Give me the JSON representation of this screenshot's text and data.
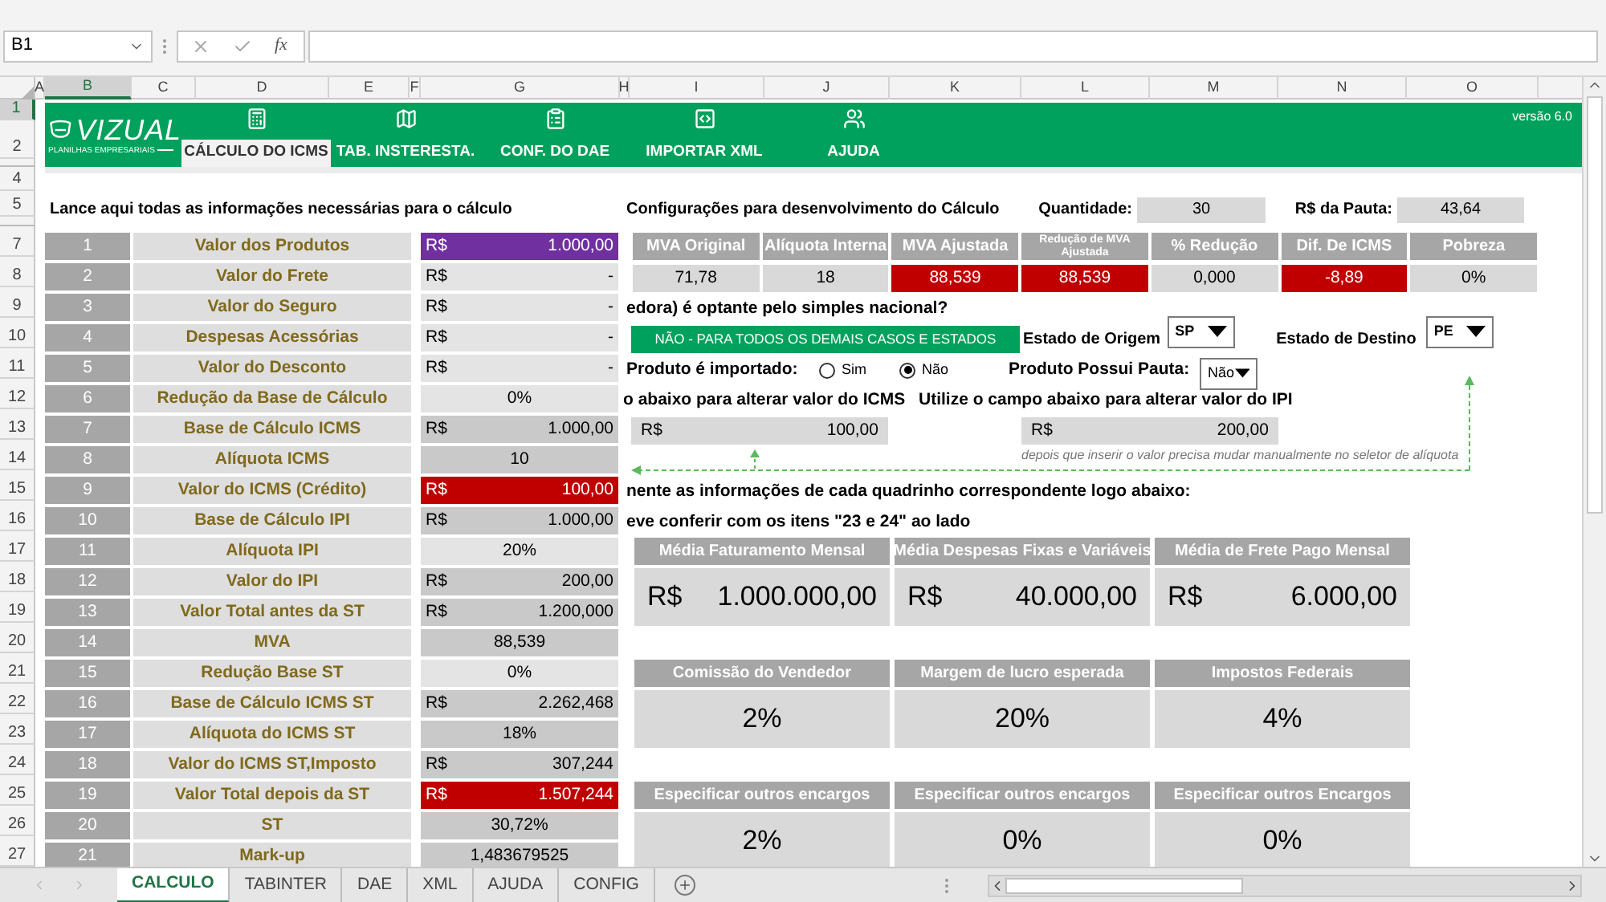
{
  "formula_bar": {
    "name_box": "B1",
    "fx": "fx"
  },
  "column_headers": [
    {
      "label": "A",
      "selected": false
    },
    {
      "label": "B",
      "selected": true
    },
    {
      "label": "C",
      "selected": false
    },
    {
      "label": "D",
      "selected": false
    },
    {
      "label": "E",
      "selected": false
    },
    {
      "label": "F",
      "selected": false
    },
    {
      "label": "G",
      "selected": false
    },
    {
      "label": "H",
      "selected": false
    },
    {
      "label": "I",
      "selected": false
    },
    {
      "label": "J",
      "selected": false
    },
    {
      "label": "K",
      "selected": false
    },
    {
      "label": "L",
      "selected": false
    },
    {
      "label": "M",
      "selected": false
    },
    {
      "label": "N",
      "selected": false
    },
    {
      "label": "O",
      "selected": false
    }
  ],
  "row_headers": [
    {
      "label": "1",
      "selected": true
    },
    {
      "label": "2",
      "selected": false
    },
    {
      "label": "4",
      "selected": false
    },
    {
      "label": "5",
      "selected": false
    },
    {
      "label": "7",
      "selected": false
    },
    {
      "label": "8",
      "selected": false
    },
    {
      "label": "9",
      "selected": false
    },
    {
      "label": "10",
      "selected": false
    },
    {
      "label": "11",
      "selected": false
    },
    {
      "label": "12",
      "selected": false
    },
    {
      "label": "13",
      "selected": false
    },
    {
      "label": "14",
      "selected": false
    },
    {
      "label": "15",
      "selected": false
    },
    {
      "label": "16",
      "selected": false
    },
    {
      "label": "17",
      "selected": false
    },
    {
      "label": "18",
      "selected": false
    },
    {
      "label": "19",
      "selected": false
    },
    {
      "label": "20",
      "selected": false
    },
    {
      "label": "21",
      "selected": false
    },
    {
      "label": "22",
      "selected": false
    },
    {
      "label": "23",
      "selected": false
    },
    {
      "label": "24",
      "selected": false
    },
    {
      "label": "25",
      "selected": false
    },
    {
      "label": "26",
      "selected": false
    },
    {
      "label": "27",
      "selected": false
    }
  ],
  "banner": {
    "logo_title": "VIZUAL",
    "logo_subtitle": "PLANILHAS EMPRESARIAIS",
    "version": "versão 6.0",
    "nav": [
      {
        "label": "CÁLCULO DO ICMS",
        "selected": true
      },
      {
        "label": "TAB. INSTERESTA.",
        "selected": false
      },
      {
        "label": "CONF. DO DAE",
        "selected": false
      },
      {
        "label": "IMPORTAR XML",
        "selected": false
      },
      {
        "label": "AJUDA",
        "selected": false
      }
    ]
  },
  "intro": "Lance aqui todas as informações necessárias para o cálculo",
  "inputs": [
    {
      "number": "1",
      "label": "Valor dos Produtos",
      "kind": "currency",
      "currency": "R$",
      "value": "1.000,00",
      "color": "#7030a0"
    },
    {
      "number": "2",
      "label": "Valor do Frete",
      "kind": "currency",
      "currency": "R$",
      "value": "-",
      "color": "#e4e4e4"
    },
    {
      "number": "3",
      "label": "Valor do Seguro",
      "kind": "currency",
      "currency": "R$",
      "value": "-",
      "color": "#e4e4e4"
    },
    {
      "number": "4",
      "label": "Despesas Acessórias",
      "kind": "currency",
      "currency": "R$",
      "value": "-",
      "color": "#e4e4e4"
    },
    {
      "number": "5",
      "label": "Valor do Desconto",
      "kind": "currency",
      "currency": "R$",
      "value": "-",
      "color": "#e4e4e4"
    },
    {
      "number": "6",
      "label": "Redução da Base de Cálculo",
      "kind": "plain",
      "value": "0%",
      "color": "#e4e4e4"
    },
    {
      "number": "7",
      "label": "Base de Cálculo ICMS",
      "kind": "currency",
      "currency": "R$",
      "value": "1.000,00",
      "color": "#c9c9c9"
    },
    {
      "number": "8",
      "label": "Alíquota ICMS",
      "kind": "plain",
      "value": "10",
      "color": "#c9c9c9"
    },
    {
      "number": "9",
      "label": "Valor do ICMS (Crédito)",
      "kind": "currency",
      "currency": "R$",
      "value": "100,00",
      "color": "#c00000"
    },
    {
      "number": "10",
      "label": "Base de Cálculo IPI",
      "kind": "currency",
      "currency": "R$",
      "value": "1.000,00",
      "color": "#c9c9c9"
    },
    {
      "number": "11",
      "label": "Alíquota IPI",
      "kind": "plain",
      "value": "20%",
      "color": "#e4e4e4"
    },
    {
      "number": "12",
      "label": "Valor do IPI",
      "kind": "currency",
      "currency": "R$",
      "value": "200,00",
      "color": "#c9c9c9"
    },
    {
      "number": "13",
      "label": "Valor Total antes da ST",
      "kind": "currency",
      "currency": "R$",
      "value": "1.200,000",
      "color": "#c9c9c9"
    },
    {
      "number": "14",
      "label": "MVA",
      "kind": "plain",
      "value": "88,539",
      "color": "#c9c9c9"
    },
    {
      "number": "15",
      "label": "Redução Base ST",
      "kind": "plain",
      "value": "0%",
      "color": "#e4e4e4"
    },
    {
      "number": "16",
      "label": "Base de Cálculo ICMS ST",
      "kind": "currency",
      "currency": "R$",
      "value": "2.262,468",
      "color": "#c9c9c9"
    },
    {
      "number": "17",
      "label": "Alíquota do ICMS ST",
      "kind": "plain",
      "value": "18%",
      "color": "#c9c9c9"
    },
    {
      "number": "18",
      "label": "Valor do ICMS ST,Imposto",
      "kind": "currency",
      "currency": "R$",
      "value": "307,244",
      "color": "#c9c9c9"
    },
    {
      "number": "19",
      "label": "Valor Total depois da ST",
      "kind": "currency",
      "currency": "R$",
      "value": "1.507,244",
      "color": "#c00000"
    },
    {
      "number": "20",
      "label": "ST",
      "kind": "plain",
      "value": "30,72%",
      "color": "#c9c9c9"
    },
    {
      "number": "21",
      "label": "Mark-up",
      "kind": "plain",
      "value": "1,483679525",
      "color": "#c9c9c9"
    }
  ],
  "config": {
    "title": "Configurações para desenvolvimento do Cálculo",
    "quantity_label": "Quantidade:",
    "quantity": "30",
    "pauta_label": "R$ da Pauta:",
    "pauta": "43,64"
  },
  "mva_table": {
    "columns": [
      "MVA Original",
      "Alíquota Interna",
      "MVA Ajustada",
      "Redução de MVA Ajustada",
      "% Redução",
      "Dif. De ICMS",
      "Pobreza"
    ],
    "values": [
      {
        "text": "71,78",
        "color": "#d9d9d9"
      },
      {
        "text": "18",
        "color": "#d9d9d9"
      },
      {
        "text": "88,539",
        "color": "#c00000"
      },
      {
        "text": "88,539",
        "color": "#c00000"
      },
      {
        "text": "0,000",
        "color": "#d9d9d9"
      },
      {
        "text": "-8,89",
        "color": "#c00000"
      },
      {
        "text": "0%",
        "color": "#d9d9d9"
      }
    ]
  },
  "simples_question": "edora) é optante pelo simples nacional?",
  "simples_answer": "NÃO - PARA TODOS OS DEMAIS CASOS E ESTADOS",
  "origin": {
    "label": "Estado de Origem",
    "value": "SP"
  },
  "destination": {
    "label": "Estado de Destino",
    "value": "PE"
  },
  "imported": {
    "label": "Produto é importado:",
    "options": [
      {
        "label": "Sim",
        "selected": false
      },
      {
        "label": "Não",
        "selected": true
      }
    ]
  },
  "pauta_select": {
    "label": "Produto Possui Pauta:",
    "value": "Não"
  },
  "icms_override": {
    "label": "o abaixo para alterar valor do ICMS",
    "currency": "R$",
    "value": "100,00"
  },
  "ipi_override": {
    "label": "Utilize o campo abaixo para alterar valor do IPI",
    "currency": "R$",
    "value": "200,00",
    "note": "depois que inserir o valor precisa mudar manualmente no seletor de alíquota"
  },
  "instructions": [
    "nente as informações de cada quadrinho correspondente logo abaixo:",
    "eve conferir com os itens \"23 e 24\" ao lado"
  ],
  "card_rows": [
    [
      {
        "title": "Média Faturamento Mensal",
        "kind": "currency",
        "currency": "R$",
        "value": "1.000.000,00"
      },
      {
        "title": "Média Despesas Fixas e Variáveis",
        "kind": "currency",
        "currency": "R$",
        "value": "40.000,00"
      },
      {
        "title": "Média de Frete Pago Mensal",
        "kind": "currency",
        "currency": "R$",
        "value": "6.000,00"
      }
    ],
    [
      {
        "title": "Comissão do Vendedor",
        "kind": "plain",
        "value": "2%"
      },
      {
        "title": "Margem de lucro esperada",
        "kind": "plain",
        "value": "20%"
      },
      {
        "title": "Impostos Federais",
        "kind": "plain",
        "value": "4%"
      }
    ],
    [
      {
        "title": "Especificar outros encargos",
        "kind": "plain",
        "value": "2%"
      },
      {
        "title": "Especificar outros encargos",
        "kind": "plain",
        "value": "0%"
      },
      {
        "title": "Especificar outros Encargos",
        "kind": "plain",
        "value": "0%"
      }
    ]
  ],
  "sheet_tabs": [
    {
      "label": "CALCULO",
      "selected": true
    },
    {
      "label": "TABINTER",
      "selected": false
    },
    {
      "label": "DAE",
      "selected": false
    },
    {
      "label": "XML",
      "selected": false
    },
    {
      "label": "AJUDA",
      "selected": false
    },
    {
      "label": "CONFIG",
      "selected": false
    }
  ]
}
